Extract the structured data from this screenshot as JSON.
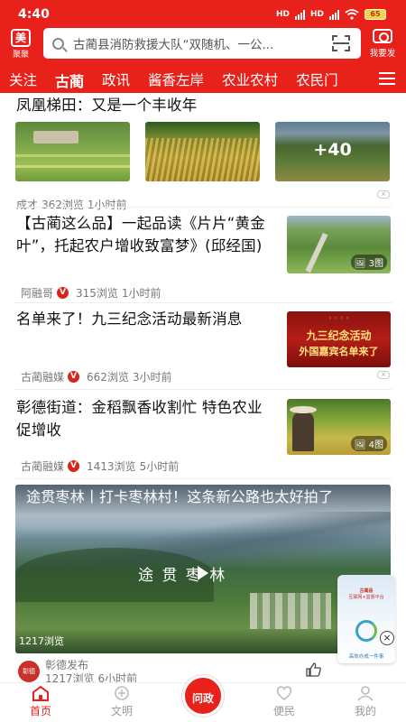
{
  "status_bar": {
    "time": "4:40",
    "network_label": "HD",
    "battery": "65"
  },
  "header": {
    "logo_label": "聚聚",
    "logo_char": "美",
    "search_placeholder": "古蔺县消防救援大队“双随机、一公...",
    "publish_label": "我要发"
  },
  "tabs": [
    {
      "label": "关注",
      "active": false
    },
    {
      "label": "古蔺",
      "active": true
    },
    {
      "label": "政讯",
      "active": false
    },
    {
      "label": "酱香左岸",
      "active": false
    },
    {
      "label": "农业农村",
      "active": false
    },
    {
      "label": "农民门",
      "active": false
    }
  ],
  "feed": [
    {
      "title": "凤凰梯田：又是一个丰收年",
      "images_more": "+40",
      "author": "成才",
      "views": "362浏览",
      "time": "1小时前"
    },
    {
      "title": "【古蔺这么品】一起品读《片片“黄金叶”，托起农户增收致富梦》(邱经国)",
      "author": "阿融哥",
      "views": "315浏览",
      "time": "1小时前",
      "image_count": "3图"
    },
    {
      "title": "名单来了！九三纪念活动最新消息",
      "author": "古蔺融媒",
      "views": "662浏览",
      "time": "3小时前",
      "thumb_line1": "九三纪念活动",
      "thumb_line2": "外国嘉宾名单来了"
    },
    {
      "title": "彰德街道：金稻飘香收割忙 特色农业促增收",
      "author": "古蔺融媒",
      "views": "1413浏览",
      "time": "5小时前",
      "image_count": "4图"
    },
    {
      "title": "途贯枣林丨打卡枣林村！这条新公路也太好拍了",
      "overlay_text": "途 贯 枣 林",
      "video_views": "1217浏览",
      "author": "彰德发布",
      "views": "1217浏览",
      "time": "6小时前"
    }
  ],
  "float_ad": {
    "line1": "古蔺县",
    "line2": "互联网+监督平台",
    "bottom": "高效办成一件事"
  },
  "bottom_nav": [
    {
      "label": "首页",
      "active": true
    },
    {
      "label": "文明",
      "active": false
    },
    {
      "label": "问政",
      "active": false
    },
    {
      "label": "便民",
      "active": false
    },
    {
      "label": "我的",
      "active": false
    }
  ],
  "colors": {
    "brand_red": "#e8211b"
  }
}
